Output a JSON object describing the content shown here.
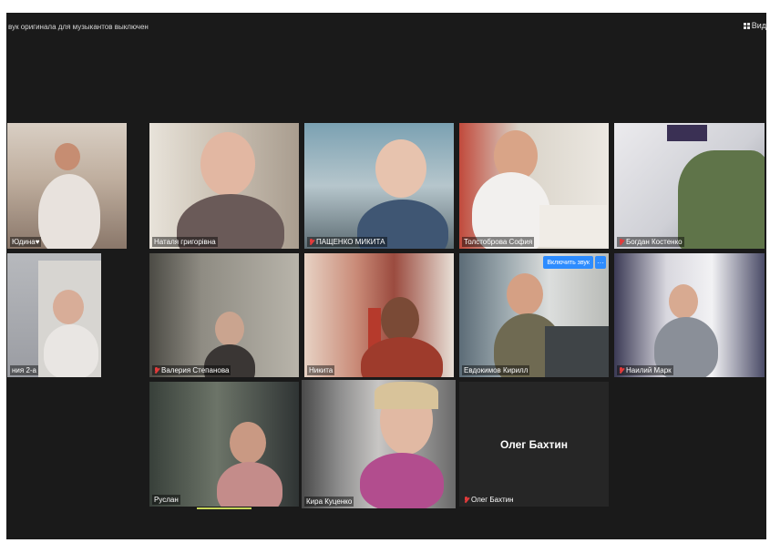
{
  "topbar": {
    "notice": "вук оригинала для музыкантов выключен",
    "view_label": "Вид"
  },
  "participants": [
    {
      "name": "Юдина♥",
      "muted": false
    },
    {
      "name": "Наталя григорівна",
      "muted": false
    },
    {
      "name": "ПАЩЕНКО МИКИТА",
      "muted": true
    },
    {
      "name": "Толстоброва София",
      "muted": false
    },
    {
      "name": "Богдан Костенко",
      "muted": true
    },
    {
      "name": "ния 2-а",
      "muted": false
    },
    {
      "name": "Валерия Степанова",
      "muted": true
    },
    {
      "name": "Никита",
      "muted": false
    },
    {
      "name": "Евдокимов Кирилл",
      "muted": false
    },
    {
      "name": "Наилий Марк",
      "muted": true
    },
    {
      "name": "Руслан",
      "muted": false
    },
    {
      "name": "Кира Куценко",
      "muted": false
    },
    {
      "name": "Олег Бахтин",
      "muted": true
    }
  ],
  "no_video_name": "Олег Бахтин",
  "unmute_button": "Включить звук",
  "more_button": "···",
  "colors": {
    "active_speaker": "#c8d75a",
    "mute": "#e23b3b",
    "accent": "#2d8cff"
  }
}
